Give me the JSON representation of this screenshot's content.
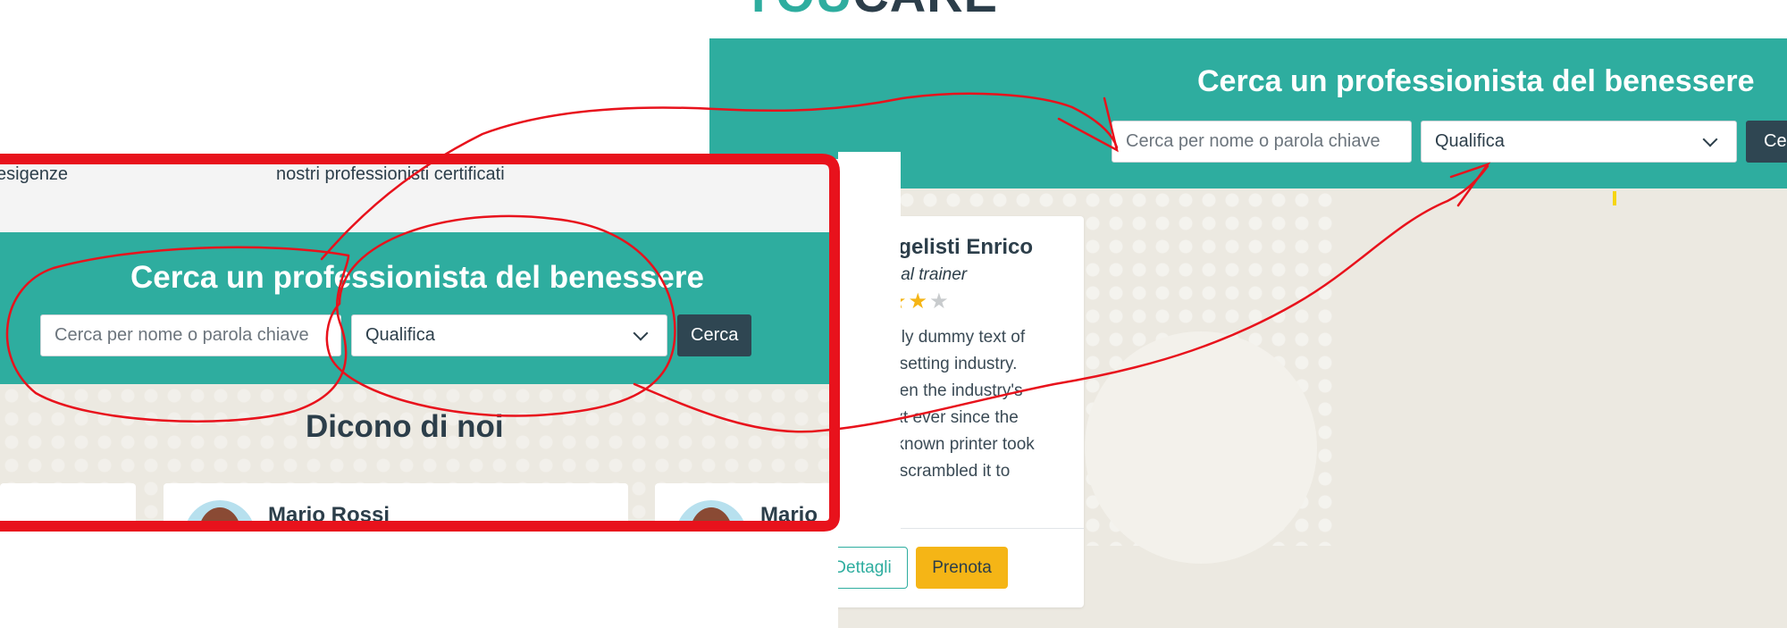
{
  "logo": {
    "part1": "YOU",
    "part2": "CARE"
  },
  "right_panel": {
    "title": "Cerca un professionista del benessere",
    "search_placeholder": "Cerca per nome o parola chiave",
    "select_value": "Qualifica",
    "search_button": "Cerca",
    "card": {
      "name": "Evangelisti Enrico",
      "role": "Personal trainer",
      "rating": 4,
      "rating_max": 5,
      "text_lines": [
        "um is simply dummy text of",
        "g and typesetting industry.",
        "um has been the industry's",
        "dummy text ever since the",
        "hen an unknown printer took",
        "f type and scrambled it to"
      ],
      "details_button": "Dettagli",
      "book_button": "Prenota"
    }
  },
  "left_panel": {
    "gray_text_1": "esigenze",
    "gray_text_2": "nostri professionisti certificati",
    "title": "Cerca un professionista del benessere",
    "search_placeholder": "Cerca per nome o parola chiave",
    "select_value": "Qualifica",
    "search_button": "Cerca",
    "section_title": "Dicono di noi",
    "testimonials": [
      {
        "name": "Mario Rossi"
      },
      {
        "name": "Mario"
      }
    ]
  },
  "colors": {
    "teal": "#2ead9f",
    "dark": "#2f4652",
    "yellow": "#f5b516",
    "annotation_red": "#e8121c",
    "background": "#ece9e1"
  }
}
